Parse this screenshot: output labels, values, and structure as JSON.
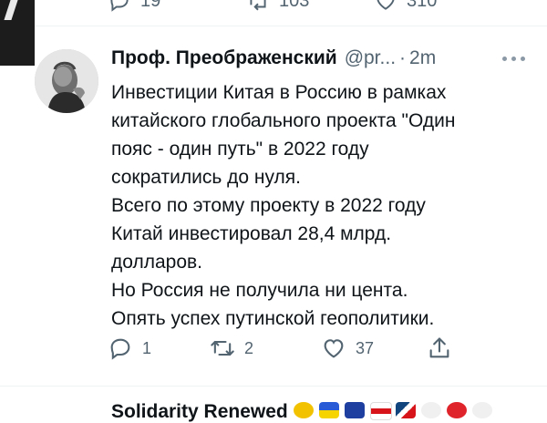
{
  "previous_tweet": {
    "reply_count": "19",
    "retweet_count": "103",
    "like_count": "310"
  },
  "tweet": {
    "author_name": "Проф. Преображенский",
    "handle": "@pr...",
    "separator": "·",
    "timestamp": "2m",
    "text_lines": [
      "Инвестиции Китая в Россию в рамках",
      "китайского глобального проекта \"Один",
      "пояс - один путь\" в 2022 году",
      "сократились до нуля.",
      "Всего по этому проекту в 2022 году",
      "Китай инвестировал 28,4 млрд.",
      "долларов.",
      "Но Россия не получила ни цента.",
      "Опять успех путинской геополитики."
    ],
    "actions": {
      "reply_count": "1",
      "retweet_count": "2",
      "like_count": "37"
    },
    "icons": {
      "reply": "reply-icon",
      "retweet": "retweet-icon",
      "like": "heart-icon",
      "share": "share-icon",
      "more": "more-icon"
    }
  },
  "next_tweet": {
    "author_name": "Solidarity Renewed"
  },
  "colors": {
    "text_primary": "#0f1419",
    "text_secondary": "#536471",
    "divider": "#eff3f4"
  }
}
